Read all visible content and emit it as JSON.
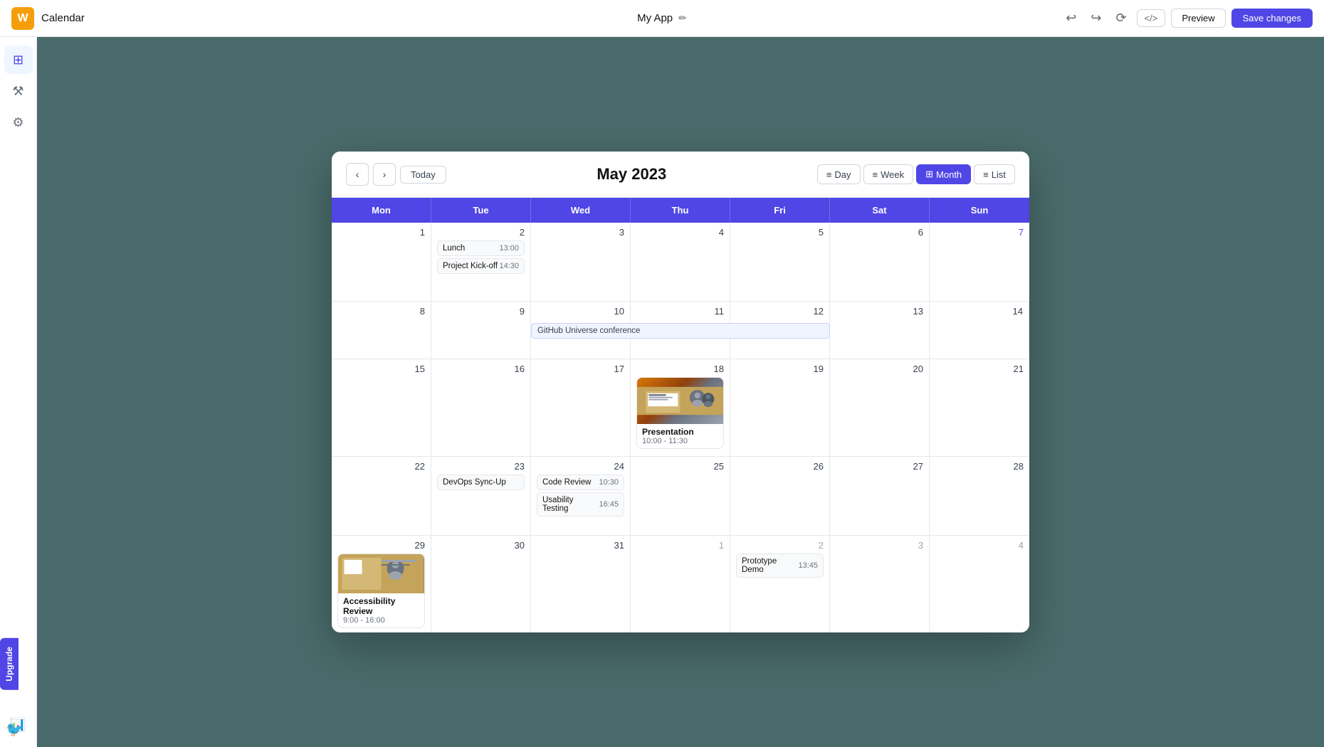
{
  "topbar": {
    "logo_text": "W",
    "page_title": "Calendar",
    "app_name": "My App",
    "edit_icon": "✏",
    "undo_icon": "↩",
    "redo_icon": "↪",
    "history_icon": "⟳",
    "code_label": "</>",
    "preview_label": "Preview",
    "save_label": "Save changes"
  },
  "sidebar": {
    "items": [
      {
        "icon": "⊞",
        "name": "dashboard",
        "label": "Dashboard"
      },
      {
        "icon": "⚒",
        "name": "tools",
        "label": "Tools"
      },
      {
        "icon": "⚙",
        "name": "settings",
        "label": "Settings"
      },
      {
        "icon": "📊",
        "name": "analytics",
        "label": "Analytics"
      }
    ]
  },
  "calendar": {
    "month_year": "May 2023",
    "nav": {
      "prev_label": "‹",
      "next_label": "›",
      "today_label": "Today"
    },
    "view_buttons": [
      {
        "label": "Day",
        "icon": "≡",
        "key": "day"
      },
      {
        "label": "Week",
        "icon": "≡",
        "key": "week"
      },
      {
        "label": "Month",
        "icon": "⊞",
        "key": "month",
        "active": true
      },
      {
        "label": "List",
        "icon": "≡",
        "key": "list"
      }
    ],
    "day_headers": [
      "Mon",
      "Tue",
      "Wed",
      "Thu",
      "Fri",
      "Sat",
      "Sun"
    ],
    "weeks": [
      {
        "days": [
          {
            "num": "1",
            "month": "current"
          },
          {
            "num": "2",
            "month": "current",
            "events": [
              {
                "type": "simple",
                "name": "Lunch",
                "time": "13:00"
              },
              {
                "type": "simple",
                "name": "Project Kick-off",
                "time": "14:30"
              }
            ]
          },
          {
            "num": "3",
            "month": "current"
          },
          {
            "num": "4",
            "month": "current"
          },
          {
            "num": "5",
            "month": "current"
          },
          {
            "num": "6",
            "month": "current"
          },
          {
            "num": "7",
            "month": "current",
            "sunday": true
          }
        ]
      },
      {
        "github_span": true,
        "github_label": "GitHub Universe conference",
        "days": [
          {
            "num": "8",
            "month": "current"
          },
          {
            "num": "9",
            "month": "current"
          },
          {
            "num": "10",
            "month": "current"
          },
          {
            "num": "11",
            "month": "current"
          },
          {
            "num": "12",
            "month": "current"
          },
          {
            "num": "13",
            "month": "current"
          },
          {
            "num": "14",
            "month": "current"
          }
        ]
      },
      {
        "days": [
          {
            "num": "15",
            "month": "current"
          },
          {
            "num": "16",
            "month": "current"
          },
          {
            "num": "17",
            "month": "current"
          },
          {
            "num": "18",
            "month": "current",
            "events": [
              {
                "type": "image-event",
                "name": "Presentation",
                "time": "10:00 - 11:30"
              }
            ]
          },
          {
            "num": "19",
            "month": "current"
          },
          {
            "num": "20",
            "month": "current"
          },
          {
            "num": "21",
            "month": "current"
          }
        ]
      },
      {
        "days": [
          {
            "num": "22",
            "month": "current"
          },
          {
            "num": "23",
            "month": "current",
            "events": [
              {
                "type": "simple",
                "name": "DevOps Sync-Up",
                "time": ""
              }
            ]
          },
          {
            "num": "24",
            "month": "current",
            "events": [
              {
                "type": "simple",
                "name": "Code Review",
                "time": "10:30"
              },
              {
                "type": "simple",
                "name": "Usability Testing",
                "time": "16:45"
              }
            ]
          },
          {
            "num": "25",
            "month": "current"
          },
          {
            "num": "26",
            "month": "current"
          },
          {
            "num": "27",
            "month": "current"
          },
          {
            "num": "28",
            "month": "current"
          }
        ]
      },
      {
        "days": [
          {
            "num": "29",
            "month": "current",
            "events": [
              {
                "type": "access",
                "name": "Accessibility Review",
                "time": "9:00 - 16:00"
              }
            ]
          },
          {
            "num": "30",
            "month": "current"
          },
          {
            "num": "31",
            "month": "current"
          },
          {
            "num": "1",
            "month": "other"
          },
          {
            "num": "2",
            "month": "other",
            "events": [
              {
                "type": "simple",
                "name": "Prototype Demo",
                "time": "13:45"
              }
            ]
          },
          {
            "num": "3",
            "month": "other"
          },
          {
            "num": "4",
            "month": "other"
          }
        ]
      }
    ]
  },
  "upgrade": {
    "label": "Upgrade"
  }
}
